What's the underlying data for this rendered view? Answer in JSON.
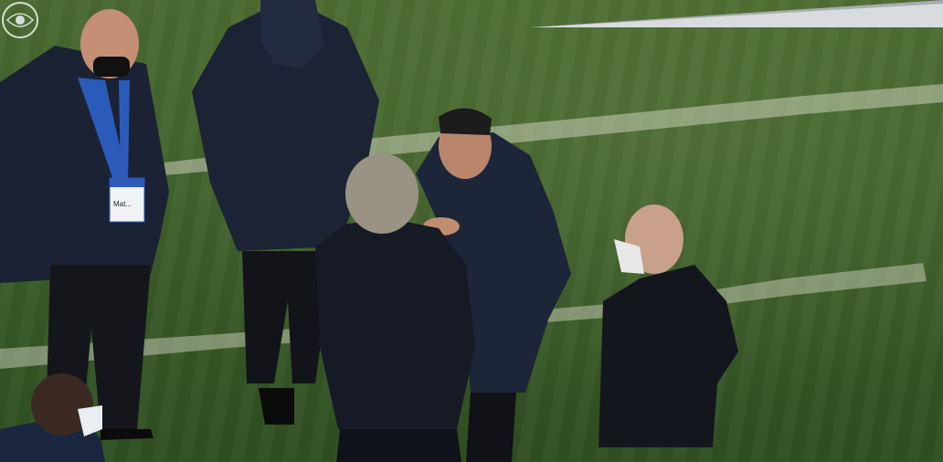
{
  "scene": {
    "type": "photo",
    "subject": "people-on-pitch-sideline",
    "colors": {
      "grass_light": "#5b7a3a",
      "grass_dark": "#2f4f22",
      "pitch_line": "#c9cdb8",
      "coat_navy": "#1a2233",
      "coat_black": "#15171d",
      "skin": "#c48f74",
      "lanyard": "#2a5bb8"
    }
  },
  "accreditation_badge": {
    "text": "Mat..."
  },
  "broadcast_logo": {
    "icon": "competition-logo-icon"
  }
}
